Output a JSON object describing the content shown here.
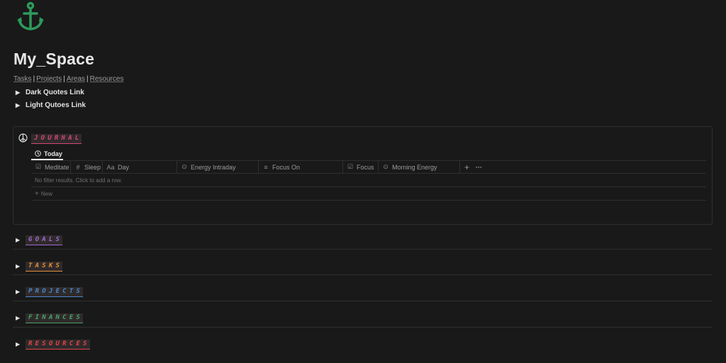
{
  "page": {
    "title": "My_Space",
    "icon": "anchor-icon",
    "icon_color": "#2e9a5c"
  },
  "nav": {
    "links": [
      "Tasks",
      "Projects",
      "Areas",
      "Resources"
    ],
    "separator": "|"
  },
  "toggles": [
    {
      "label": "Dark Quotes Link"
    },
    {
      "label": "Light Qutoes Link"
    }
  ],
  "journal": {
    "icon": "peace-icon",
    "heading": "JOURNAL",
    "heading_color": "#d6457a",
    "view_tab": {
      "icon": "clock-icon",
      "label": "Today"
    },
    "columns": [
      {
        "icon": "checkbox-icon",
        "glyph": "☑",
        "label": "Meditate"
      },
      {
        "icon": "number-icon",
        "glyph": "#",
        "label": "Sleep"
      },
      {
        "icon": "text-icon",
        "glyph": "Aa",
        "label": "Day"
      },
      {
        "icon": "select-icon",
        "glyph": "⊙",
        "label": "Energy Intraday"
      },
      {
        "icon": "list-icon",
        "glyph": "≡",
        "label": "Focus On"
      },
      {
        "icon": "checkbox-icon",
        "glyph": "☑",
        "label": "Focus"
      },
      {
        "icon": "select-icon",
        "glyph": "⊙",
        "label": "Morning Energy"
      }
    ],
    "add_column_glyph": "+",
    "more_glyph": "···",
    "empty_message": "No filter results. Click to add a row.",
    "new_label": "New",
    "new_glyph": "+"
  },
  "sections": [
    {
      "heading": "GOALS",
      "color": "#a06bd1"
    },
    {
      "heading": "TASKS",
      "color": "#e0903a"
    },
    {
      "heading": "PROJECTS",
      "color": "#4a87c9"
    },
    {
      "heading": "FINANCES",
      "color": "#4aa36b"
    },
    {
      "heading": "RESOURCES",
      "color": "#e0454a"
    }
  ],
  "toggle_glyph": "▶"
}
